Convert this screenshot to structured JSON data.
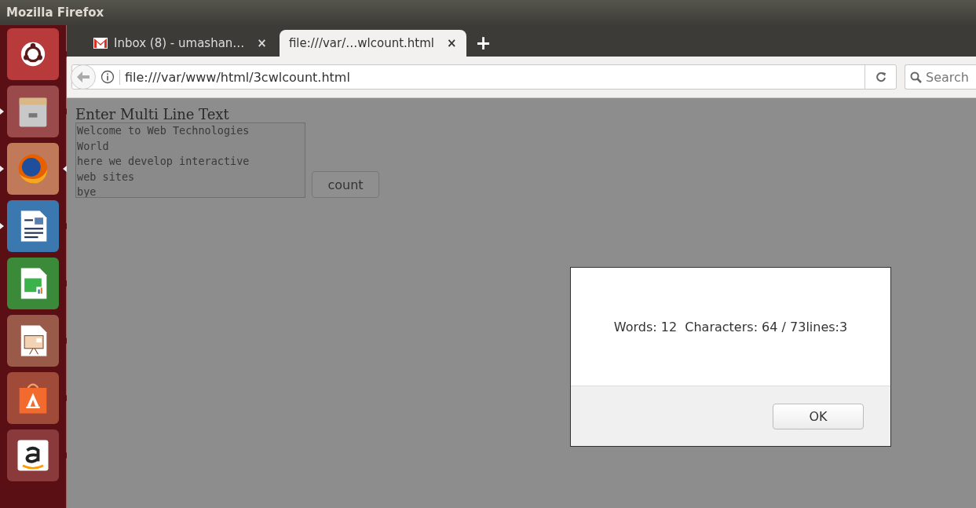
{
  "window": {
    "title": "Mozilla Firefox"
  },
  "launcher": {
    "items": [
      {
        "kind": "ubuntu",
        "running": false,
        "focused": false
      },
      {
        "kind": "files",
        "running": true,
        "focused": false
      },
      {
        "kind": "firefox",
        "running": true,
        "focused": true
      },
      {
        "kind": "writer",
        "running": true,
        "focused": false
      },
      {
        "kind": "calc",
        "running": false,
        "focused": false
      },
      {
        "kind": "impress",
        "running": false,
        "focused": false
      },
      {
        "kind": "store",
        "running": false,
        "focused": false
      },
      {
        "kind": "amazon",
        "running": false,
        "focused": false
      }
    ]
  },
  "tabs": [
    {
      "label": "Inbox (8) - umashan…",
      "kind": "mail",
      "selected": false,
      "close": "×"
    },
    {
      "label": "file:///var/…wlcount.html",
      "kind": "page",
      "selected": true,
      "close": "×"
    }
  ],
  "new_tab": "+",
  "address_bar": {
    "value": "file:///var/www/html/3cwlcount.html"
  },
  "search": {
    "placeholder": "Search"
  },
  "page": {
    "heading": "Enter Multi Line Text",
    "textarea": {
      "value": "Welcome to Web Technologies\nWorld\nhere we develop interactive\nweb sites\nbye"
    },
    "button": "count"
  },
  "dialog": {
    "message": "Words: 12  Characters: 64 / 73lines:3",
    "button": "OK"
  }
}
